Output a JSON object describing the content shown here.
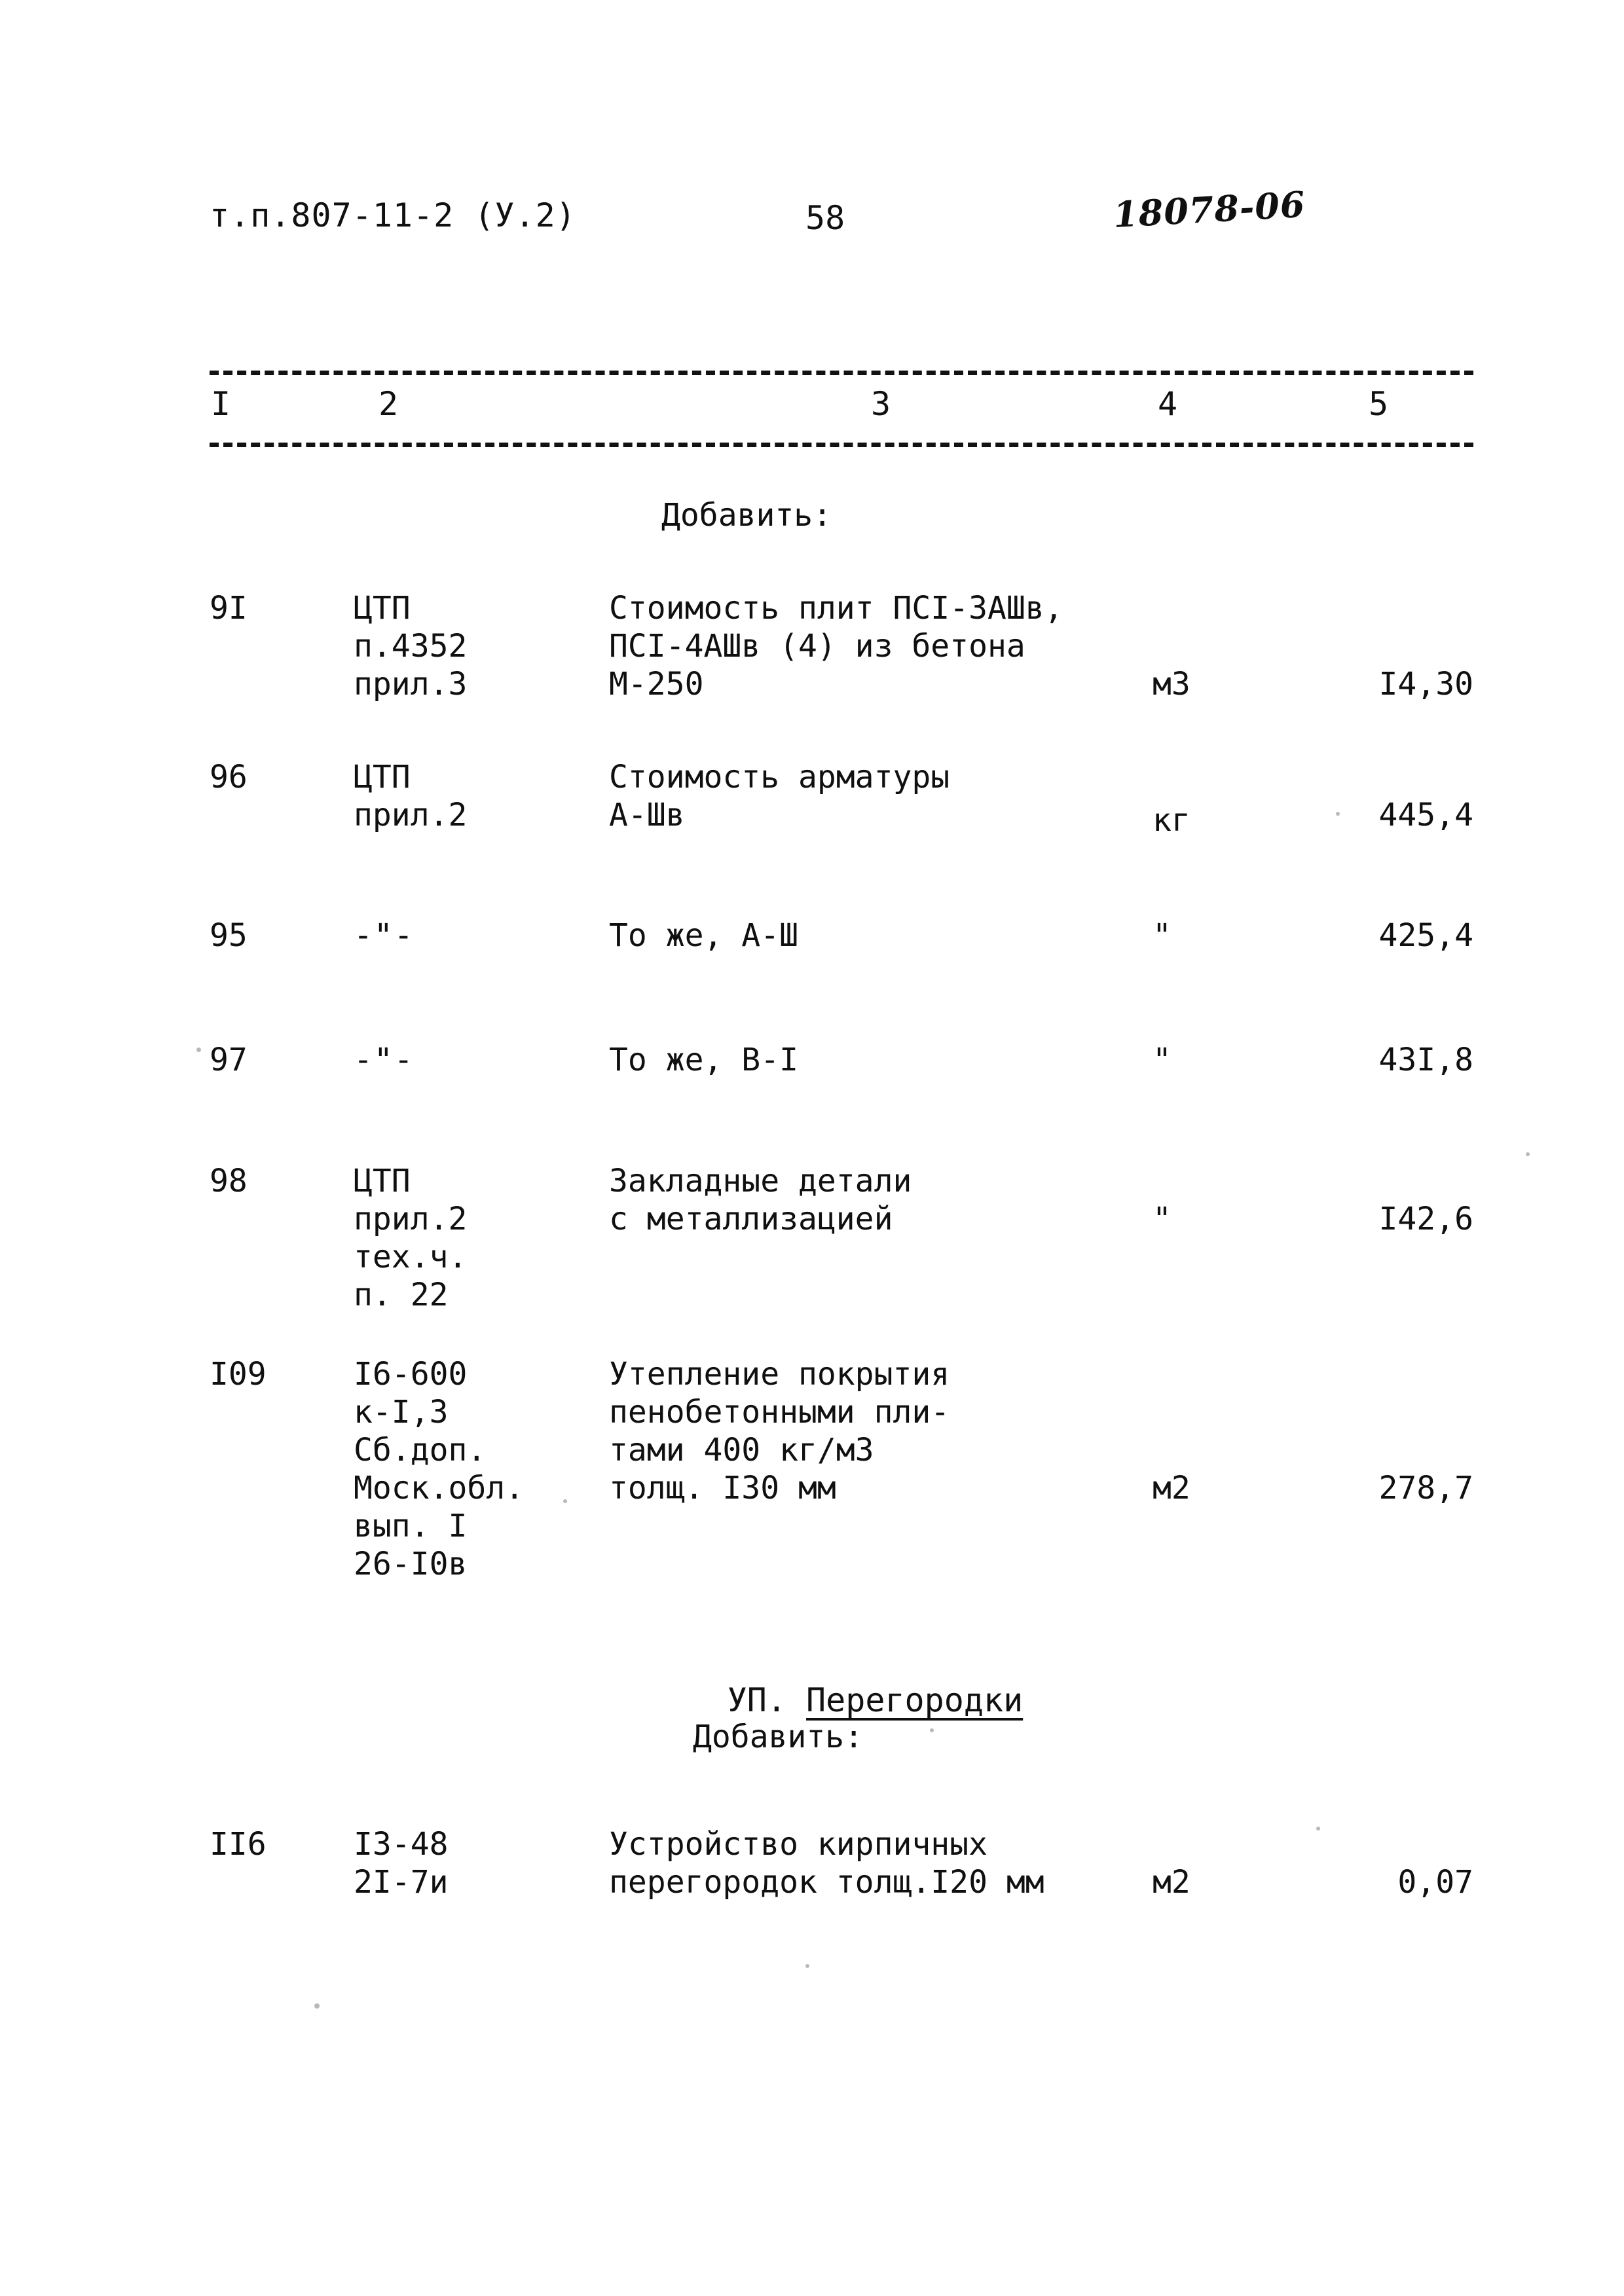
{
  "header": {
    "doc_code": "т.п.807-11-2 (У.2)",
    "page_number": "58",
    "hand_annotation": "18078-06"
  },
  "table": {
    "column_numbers": [
      "I",
      "2",
      "3",
      "4",
      "5"
    ],
    "labels": {
      "add_first": "Добавить:",
      "add_second": "Добавить:"
    },
    "section": {
      "prefix": "УП.",
      "title": "Перегородки"
    },
    "rows": [
      {
        "number": "9I",
        "justification": "ЦТП\nп.4352\nприл.3",
        "description": "Стоимость плит ПСI-ЗАШв,\nПСI-4АШв (4) из бетона\nМ-250",
        "unit": "м3",
        "value": "I4,30"
      },
      {
        "number": "96",
        "justification": "ЦТП\nприл.2",
        "description": "Стоимость арматуры\nА-Шв",
        "unit": "кг",
        "value": "445,4"
      },
      {
        "number": "95",
        "justification": "-\"-",
        "description": "То же, А-Ш",
        "unit": "\"",
        "value": "425,4"
      },
      {
        "number": "97",
        "justification": "-\"-",
        "description": "То же, В-I",
        "unit": "\"",
        "value": "43I,8"
      },
      {
        "number": "98",
        "justification": "ЦТП\nприл.2\nтех.ч.\nп. 22",
        "description": "Закладные детали\nс металлизацией",
        "unit": "\"",
        "value": "I42,6"
      },
      {
        "number": "I09",
        "justification": "I6-600\nк-I,3\nСб.доп.\nМоск.обл.\nвып. I\n26-I0в",
        "description": "Утепление покрытия\nпенобетонными пли-\nтами 400 кг/м3\nтолщ. I30 мм",
        "unit": "м2",
        "value": "278,7"
      },
      {
        "number": "II6",
        "justification": "I3-48\n2I-7и",
        "description": "Устройство кирпичных\nперегородок толщ.I20 мм",
        "unit": "м2",
        "value": "0,07"
      }
    ]
  }
}
